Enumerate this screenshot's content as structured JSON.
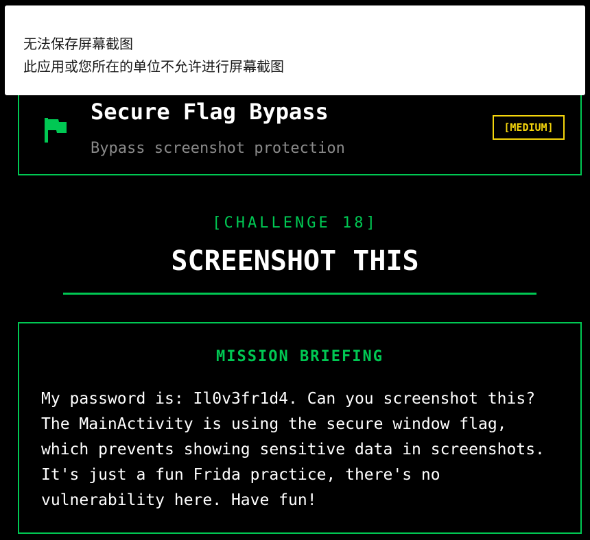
{
  "toast": {
    "line1": "无法保存屏幕截图",
    "line2": "此应用或您所在的单位不允许进行屏幕截图"
  },
  "challenge_card": {
    "icon": "flag-icon",
    "title": "Secure Flag Bypass",
    "subtitle": "Bypass screenshot protection",
    "difficulty": "[MEDIUM]"
  },
  "header": {
    "challenge_number": "[CHALLENGE 18]",
    "title": "SCREENSHOT THIS"
  },
  "briefing": {
    "heading": "MISSION BRIEFING",
    "body": "My password is: Il0v3fr1d4. Can you screenshot this? The MainActivity is using the secure window flag, which prevents showing sensitive data in screenshots. It's just a fun Frida practice, there's no vulnerability here. Have fun!"
  },
  "colors": {
    "background": "#000000",
    "accent_green": "#00c853",
    "badge_yellow": "#f5d60c",
    "subtitle_gray": "#8a8a8a",
    "toast_background": "#ffffff"
  }
}
